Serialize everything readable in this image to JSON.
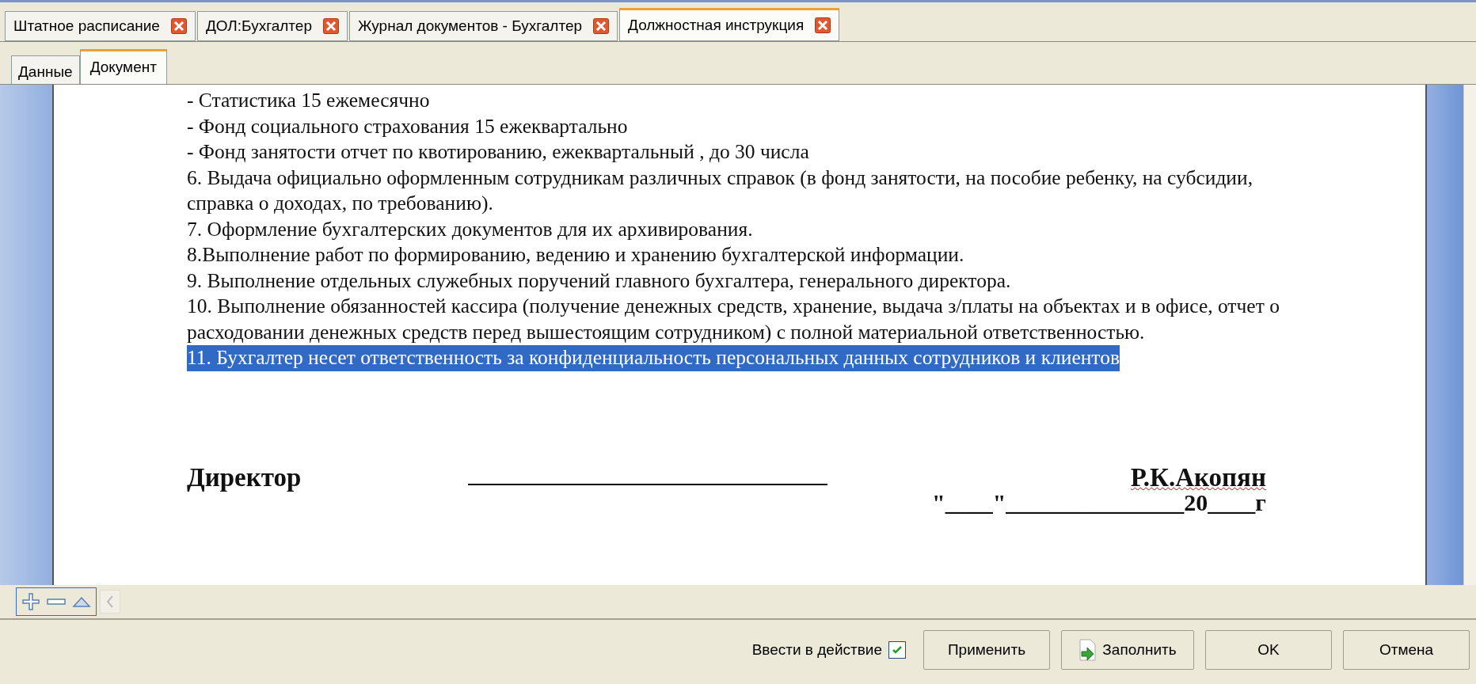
{
  "tabs": [
    {
      "label": "Штатное расписание",
      "selected": false
    },
    {
      "label": "ДОЛ:Бухгалтер",
      "selected": false
    },
    {
      "label": "Журнал документов - Бухгалтер",
      "selected": false
    },
    {
      "label": "Должностная инструкция",
      "selected": true
    }
  ],
  "subtabs": [
    {
      "label": "Данные",
      "selected": false
    },
    {
      "label": "Документ",
      "selected": true
    }
  ],
  "document": {
    "paragraphs": [
      {
        "text": "- Статистика 15 ежемесячно",
        "selected": false
      },
      {
        "text": "- Фонд социального страхования 15 ежеквартально",
        "selected": false
      },
      {
        "text": "- Фонд занятости отчет по квотированию, ежеквартальный , до 30 числа",
        "selected": false
      },
      {
        "text": "6. Выдача официально оформленным сотрудникам различных справок (в фонд занятости, на пособие ребенку, на субсидии, справка о доходах, по требованию).",
        "selected": false
      },
      {
        "text": "7. Оформление бухгалтерских документов для их архивирования.",
        "selected": false
      },
      {
        "text": "8.Выполнение работ по формированию, ведению и хранению бухгалтерской информации.",
        "selected": false
      },
      {
        "text": "9. Выполнение отдельных служебных поручений главного бухгалтера, генерального директора.",
        "selected": false
      },
      {
        "text": "10. Выполнение обязанностей кассира (получение денежных средств, хранение, выдача з/платы на объектах и в офисе, отчет о расходовании денежных средств перед вышестоящим сотрудником) с полной материальной ответственностью.",
        "selected": false
      },
      {
        "text": "11. Бухгалтер несет ответственность за конфиденциальность персональных данных сотрудников и клиентов",
        "selected": true
      }
    ],
    "signature": {
      "title": "Директор",
      "name": "Р.К.Акопян",
      "date": "\"____\"_______________20____г"
    }
  },
  "footer": {
    "checkbox": {
      "label": "Ввести в действие",
      "checked": true
    },
    "buttons": [
      {
        "label": "Применить",
        "kind": "plain"
      },
      {
        "label": "Заполнить",
        "kind": "fill"
      },
      {
        "label": "OK",
        "kind": "plain"
      },
      {
        "label": "Отмена",
        "kind": "plain"
      }
    ]
  }
}
